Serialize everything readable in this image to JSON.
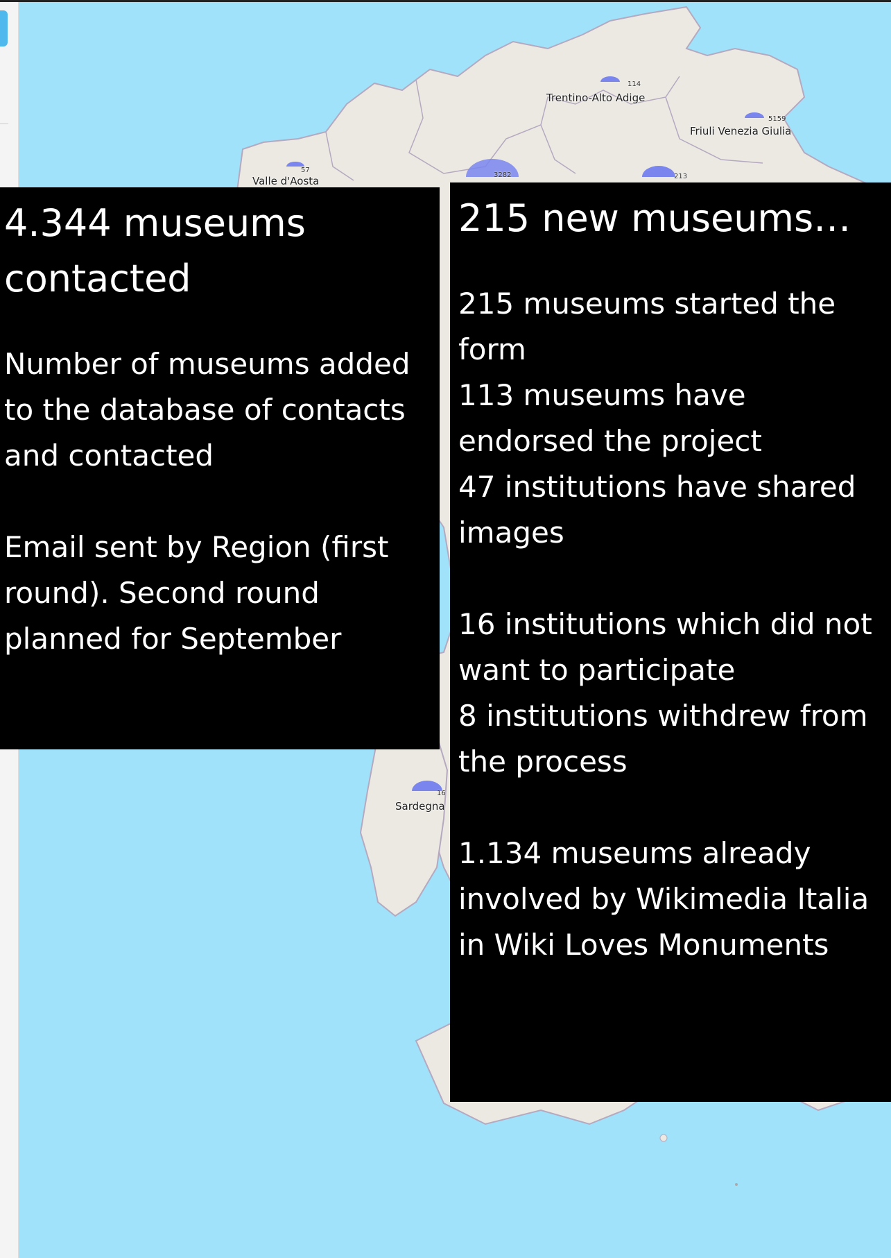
{
  "map": {
    "regions": [
      {
        "label": "Trentino-Alto Adige",
        "count": "114"
      },
      {
        "label": "Friuli Venezia Giulia",
        "count": "5159"
      },
      {
        "label": "Valle d'Aosta",
        "count": "57"
      },
      {
        "label": "Sardegna",
        "count": "16"
      }
    ],
    "other_counts": [
      "3282",
      "213"
    ],
    "colors": {
      "sea": "#9fe2fa",
      "land": "#ece9e3",
      "border": "#b5a9c0",
      "marker": "#7a86ee"
    }
  },
  "left_panel": {
    "heading": "4.344 museums contacted",
    "paragraph1": "Number of museums added to the database of contacts and contacted",
    "paragraph2": "Email sent by Region (first round). Second round planned for September"
  },
  "right_panel": {
    "heading": "215 new museums…",
    "stats_group1": [
      "215 museums started the form",
      "113 museums have endorsed the project",
      "47 institutions have shared images"
    ],
    "stats_group2": [
      "16 institutions which did not want to participate",
      "8 institutions withdrew from the process"
    ],
    "stats_group3": [
      "1.134 museums already involved by Wikimedia Italia in Wiki Loves Monuments"
    ]
  }
}
